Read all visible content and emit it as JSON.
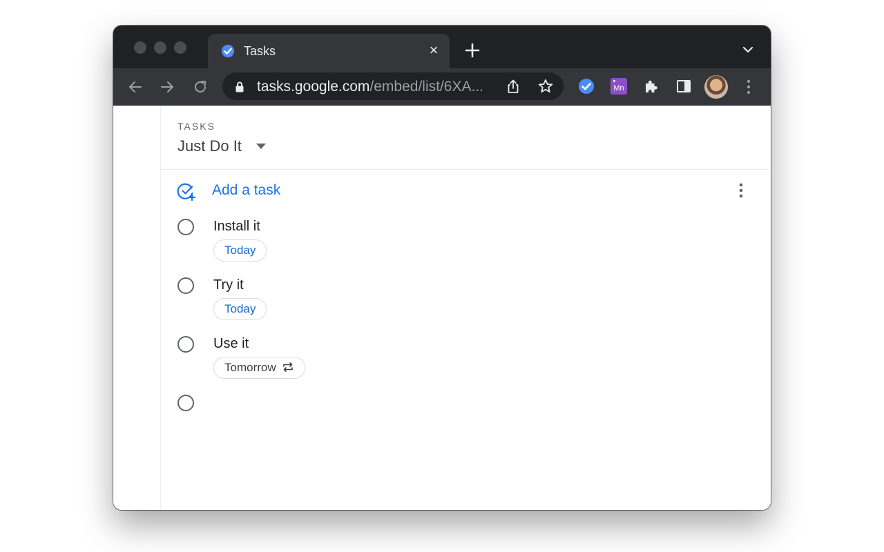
{
  "browser": {
    "tab_title": "Tasks",
    "tab_close": "×",
    "url_host": "tasks.google.com",
    "url_path": "/embed/list/6XA...",
    "ext_mn_label": "Mn"
  },
  "header": {
    "section_label": "TASKS",
    "list_name": "Just Do It"
  },
  "add_task_label": "Add a task",
  "tasks": [
    {
      "title": "Install it",
      "due": "Today",
      "repeat": false
    },
    {
      "title": "Try it",
      "due": "Today",
      "repeat": false
    },
    {
      "title": "Use it",
      "due": "Tomorrow",
      "repeat": true
    },
    {
      "title": "",
      "due": "",
      "repeat": false
    }
  ],
  "colors": {
    "accent": "#1a73e8",
    "chip_today": "#1967d2",
    "tab_strip": "#202124",
    "toolbar": "#35363a"
  },
  "icons": [
    "tasks-favicon-icon",
    "close-icon",
    "plus-icon",
    "chevron-down-icon",
    "back-arrow-icon",
    "forward-arrow-icon",
    "reload-icon",
    "lock-icon",
    "share-icon",
    "star-icon",
    "tasks-extension-icon",
    "puzzle-extension-icon",
    "side-panel-icon",
    "kebab-menu-icon",
    "add-task-icon",
    "repeat-icon",
    "caret-down-icon"
  ]
}
